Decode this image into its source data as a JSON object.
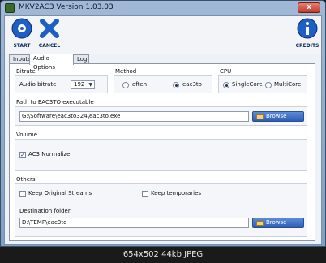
{
  "window": {
    "title": "MKV2AC3 Version 1.03.03",
    "close_label": "x"
  },
  "toolbar": {
    "start_label": "START",
    "cancel_label": "CANCEL",
    "credits_label": "CREDITS"
  },
  "tabs": [
    {
      "label": "Inputs"
    },
    {
      "label": "Audio Options"
    },
    {
      "label": "Log"
    }
  ],
  "active_tab": "Audio Options",
  "bitrate": {
    "group_title": "Bitrate",
    "label": "Audio bitrate",
    "value": "192"
  },
  "method": {
    "group_title": "Method",
    "options": [
      {
        "label": "aften",
        "selected": false
      },
      {
        "label": "eac3to",
        "selected": true
      }
    ]
  },
  "cpu": {
    "group_title": "CPU",
    "options": [
      {
        "label": "SingleCore",
        "selected": true
      },
      {
        "label": "MultiCore",
        "selected": false
      }
    ]
  },
  "eac3to": {
    "group_title": "Path to EAC3TO executable",
    "path": "G:\\Software\\eac3to324\\eac3to.exe",
    "browse_label": "Browse"
  },
  "volume": {
    "group_title": "Volume",
    "normalize_label": "AC3 Normalize",
    "normalize_checked": true
  },
  "others": {
    "group_title": "Others",
    "keep_streams_label": "Keep Original Streams",
    "keep_streams_checked": false,
    "keep_temp_label": "Keep temporaries",
    "keep_temp_checked": false,
    "dest_label": "Destination folder",
    "dest_path": "D:\\TEMP\\eac3to",
    "browse_label": "Browse"
  },
  "caption": "654x502 44kb JPEG"
}
